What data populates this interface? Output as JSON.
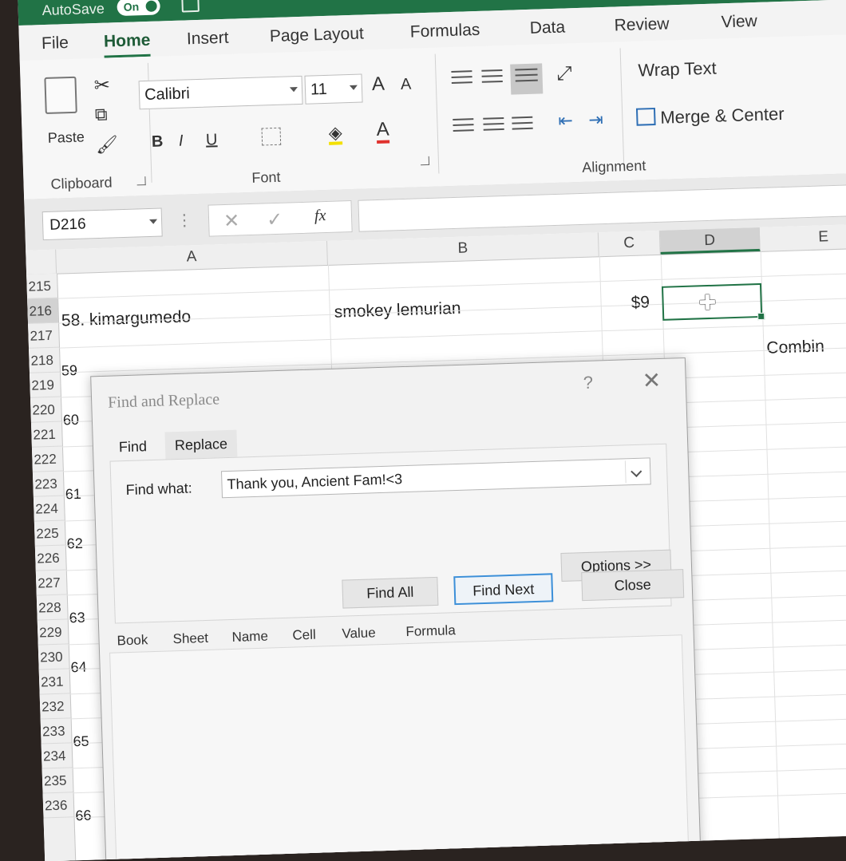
{
  "titlebar": {
    "autosave_label": "AutoSave",
    "autosave_state": "On"
  },
  "tabs": [
    {
      "label": "File"
    },
    {
      "label": "Home"
    },
    {
      "label": "Insert"
    },
    {
      "label": "Page Layout"
    },
    {
      "label": "Formulas"
    },
    {
      "label": "Data"
    },
    {
      "label": "Review"
    },
    {
      "label": "View"
    }
  ],
  "ribbon": {
    "clipboard": {
      "paste_label": "Paste",
      "group_label": "Clipboard"
    },
    "font": {
      "name": "Calibri",
      "size": "11",
      "group_label": "Font",
      "bold": "B",
      "italic": "I",
      "underline": "U",
      "grow": "A",
      "shrink": "A",
      "color_a": "A"
    },
    "alignment": {
      "wrap_text": "Wrap Text",
      "merge_center": "Merge & Center",
      "group_label": "Alignment"
    }
  },
  "formula_bar": {
    "name_box": "D216",
    "fx": "fx",
    "formula": ""
  },
  "columns": [
    "A",
    "B",
    "C",
    "D",
    "E"
  ],
  "rows": [
    "215",
    "216",
    "217",
    "218",
    "219",
    "220",
    "221",
    "222",
    "223",
    "224",
    "225",
    "226",
    "227",
    "228",
    "229",
    "230",
    "231",
    "232",
    "233",
    "234",
    "235",
    "236"
  ],
  "cells": {
    "a216": "58. kimargumedo",
    "b216": "smokey lemurian",
    "c216": "$9",
    "e218": "Combin",
    "a218": "59",
    "a220": "60",
    "a223": "61",
    "a225": "62",
    "a228": "63",
    "a230": "64",
    "a233": "65",
    "a236": "66"
  },
  "dialog": {
    "title": "Find and Replace",
    "help": "?",
    "tabs": {
      "find": "Find",
      "replace": "Replace"
    },
    "find_label": "Find what:",
    "find_value": "Thank you, Ancient Fam!<3",
    "options": "Options >>",
    "find_all": "Find All",
    "find_next": "Find Next",
    "close": "Close",
    "result_columns": [
      "Book",
      "Sheet",
      "Name",
      "Cell",
      "Value",
      "Formula"
    ]
  }
}
